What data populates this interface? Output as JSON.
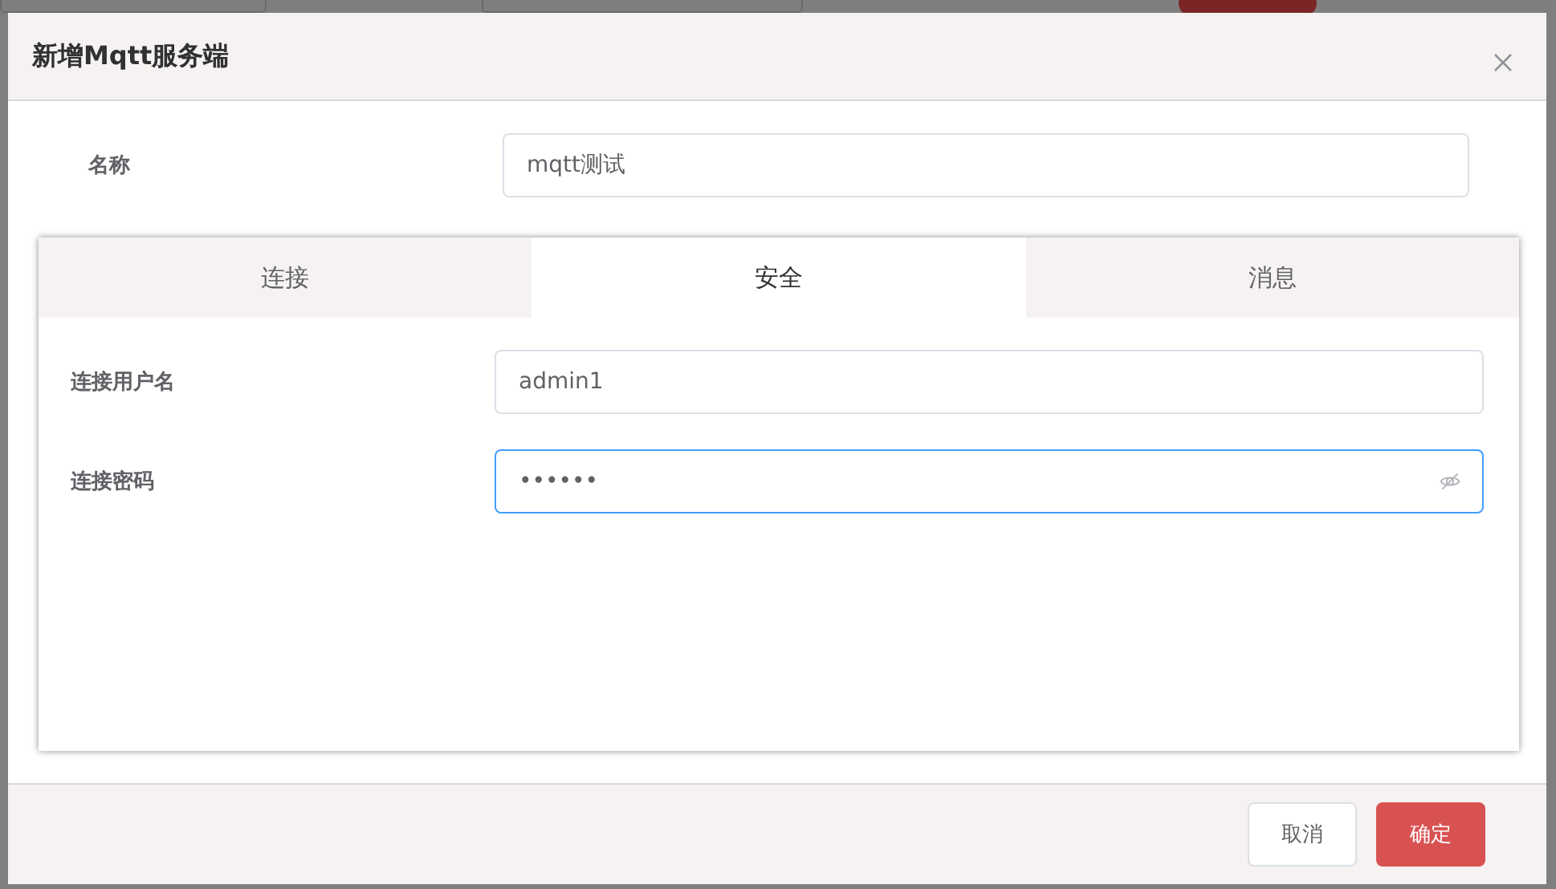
{
  "dialog": {
    "title": "新增Mqtt服务端"
  },
  "name_field": {
    "label": "名称",
    "value": "mqtt测试"
  },
  "tabs": [
    {
      "label": "连接",
      "selected": false
    },
    {
      "label": "安全",
      "selected": true
    },
    {
      "label": "消息",
      "selected": false
    }
  ],
  "fields": [
    {
      "label": "连接用户名",
      "value": "admin1",
      "kind": "text",
      "focused": false
    },
    {
      "label": "连接密码",
      "value": "••••••",
      "kind": "password",
      "focused": true
    }
  ],
  "buttons": [
    {
      "label": "取消",
      "kind": "default"
    },
    {
      "label": "确定",
      "kind": "primary"
    }
  ]
}
